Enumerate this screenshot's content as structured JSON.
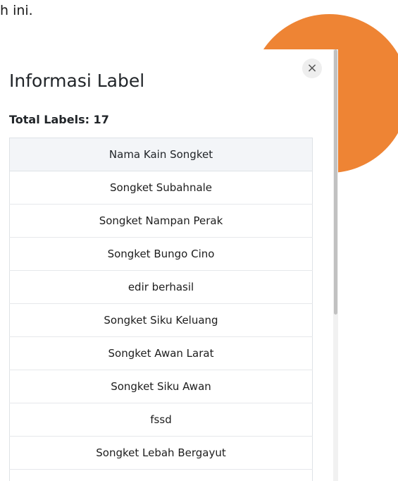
{
  "background": {
    "text": "h ini.",
    "accent_color": "#ee8434"
  },
  "modal": {
    "close_label": "×",
    "close_icon": "close-icon",
    "title": "Informasi Label",
    "total_text": "Total Labels: 17",
    "table": {
      "header": "Nama Kain Songket",
      "rows": [
        "Songket Subahnale",
        "Songket Nampan Perak",
        "Songket Bungo Cino",
        "edir berhasil",
        "Songket Siku Keluang",
        "Songket Awan Larat",
        "Songket Siku Awan",
        "fssd",
        "Songket Lebah Bergayut",
        ""
      ]
    }
  }
}
